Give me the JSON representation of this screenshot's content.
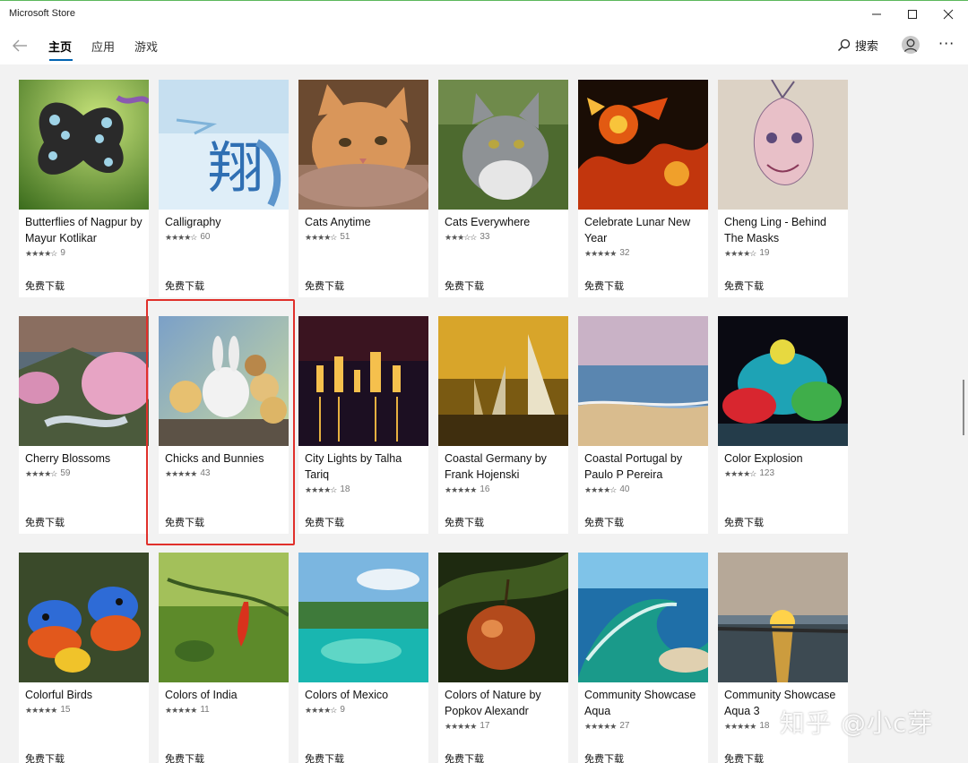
{
  "window": {
    "title": "Microsoft Store",
    "minimize_icon": "minimize-icon",
    "maximize_icon": "maximize-icon",
    "close_icon": "close-icon"
  },
  "nav": {
    "tabs": [
      {
        "label": "主页",
        "active": true
      },
      {
        "label": "应用",
        "active": false
      },
      {
        "label": "游戏",
        "active": false
      }
    ],
    "search_label": "搜索",
    "accent": "#0063b1"
  },
  "items": [
    {
      "name": "Butterflies of Nagpur by Mayur Kotlikar",
      "stars": 4,
      "count": "9",
      "price": "免费下载",
      "icon": "butterfly-image"
    },
    {
      "name": "Calligraphy",
      "stars": 4,
      "count": "60",
      "price": "免费下载",
      "icon": "calligraphy-image"
    },
    {
      "name": "Cats Anytime",
      "stars": 3.5,
      "count": "51",
      "price": "免费下载",
      "icon": "cat-image"
    },
    {
      "name": "Cats Everywhere",
      "stars": 3,
      "count": "33",
      "price": "免费下载",
      "icon": "grey-cat-image"
    },
    {
      "name": "Celebrate Lunar New Year",
      "stars": 4.5,
      "count": "32",
      "price": "免费下载",
      "icon": "dragon-lantern-image"
    },
    {
      "name": "Cheng Ling - Behind The Masks",
      "stars": 3.5,
      "count": "19",
      "price": "免费下载",
      "icon": "mask-art-image"
    },
    {
      "name": "Cherry Blossoms",
      "stars": 4,
      "count": "59",
      "price": "免费下载",
      "icon": "cherry-blossom-image"
    },
    {
      "name": "Chicks and Bunnies",
      "stars": 4.5,
      "count": "43",
      "price": "免费下载",
      "icon": "chicks-bunny-image"
    },
    {
      "name": "City Lights by Talha Tariq",
      "stars": 3.5,
      "count": "18",
      "price": "免费下载",
      "icon": "city-night-image"
    },
    {
      "name": "Coastal Germany by Frank Hojenski",
      "stars": 5,
      "count": "16",
      "price": "免费下载",
      "icon": "sailboats-image"
    },
    {
      "name": "Coastal Portugal by Paulo P Pereira",
      "stars": 4,
      "count": "40",
      "price": "免费下载",
      "icon": "beach-image"
    },
    {
      "name": "Color Explosion",
      "stars": 4,
      "count": "123",
      "price": "免费下载",
      "icon": "color-powder-image"
    },
    {
      "name": "Colorful Birds",
      "stars": 5,
      "count": "15",
      "price": "免费下载",
      "icon": "parrots-image"
    },
    {
      "name": "Colors of India",
      "stars": 5,
      "count": "11",
      "price": "免费下载",
      "icon": "chili-image"
    },
    {
      "name": "Colors of Mexico",
      "stars": 3.5,
      "count": "9",
      "price": "免费下载",
      "icon": "lagoon-image"
    },
    {
      "name": "Colors of Nature by Popkov Alexandr",
      "stars": 5,
      "count": "17",
      "price": "免费下载",
      "icon": "fruit-image"
    },
    {
      "name": "Community Showcase Aqua",
      "stars": 4.5,
      "count": "27",
      "price": "免费下载",
      "icon": "wave-image"
    },
    {
      "name": "Community Showcase Aqua 3",
      "stars": 4.5,
      "count": "18",
      "price": "免费下载",
      "icon": "sunset-lake-image"
    }
  ],
  "watermark": "知乎 @小c芽"
}
